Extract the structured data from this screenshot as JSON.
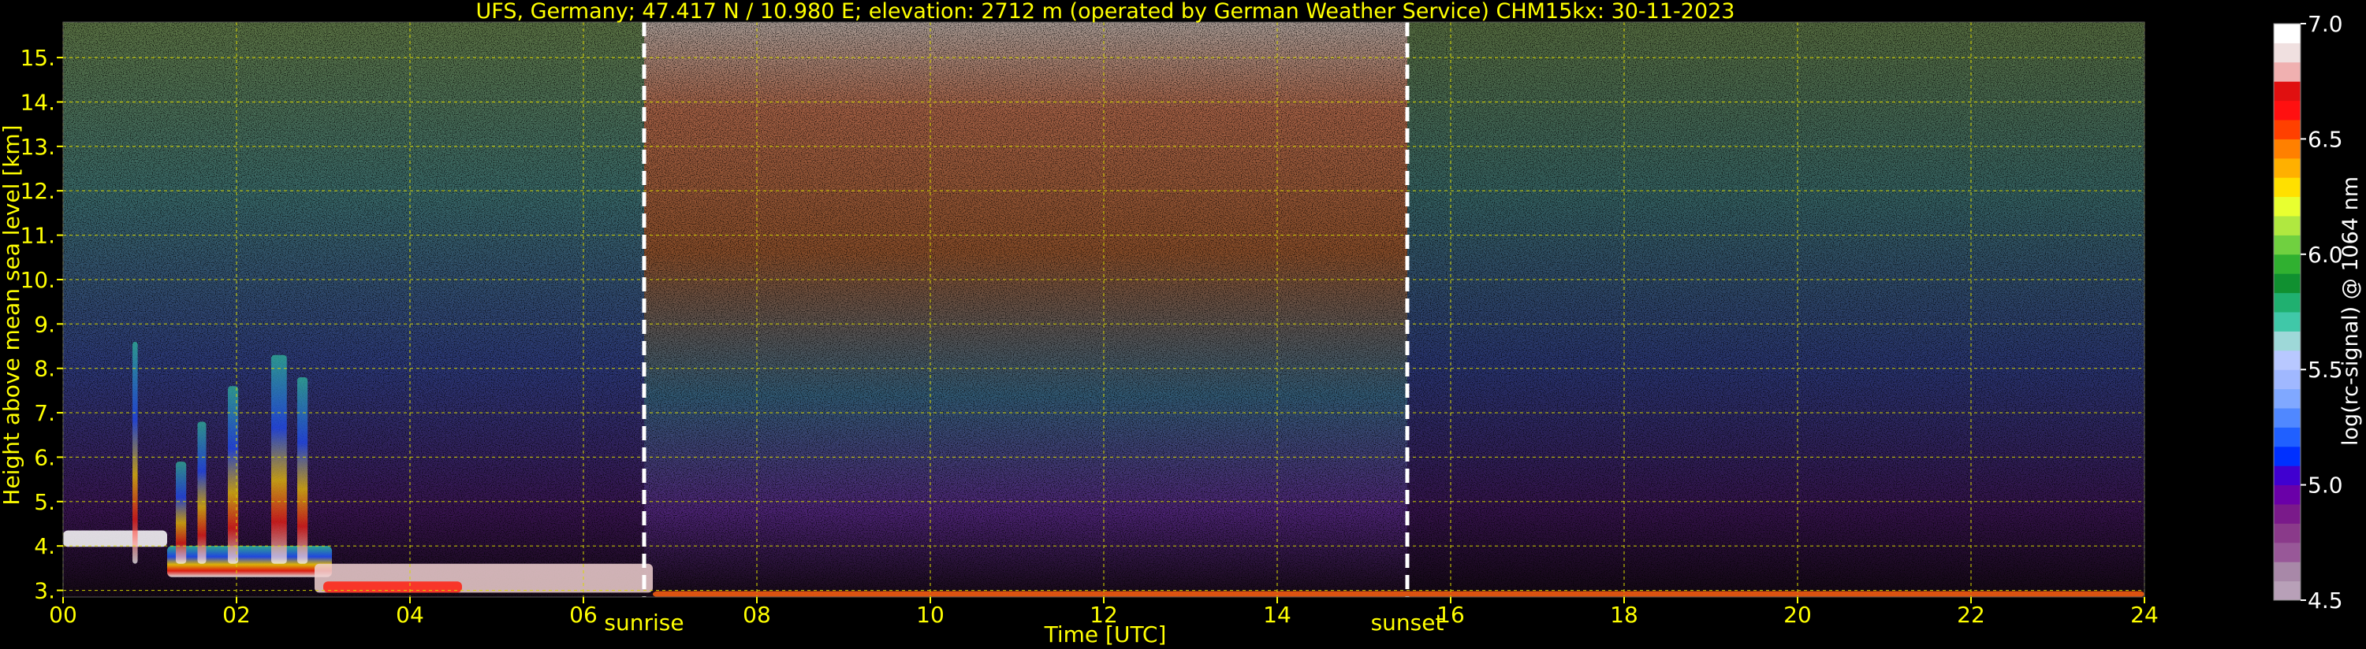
{
  "chart_data": {
    "type": "heatmap",
    "title": "UFS, Germany; 47.417 N / 10.980 E; elevation: 2712 m  (operated by German Weather Service)    CHM15kx: 30-11-2023",
    "xlabel": "Time [UTC]",
    "ylabel": "Height above mean sea level [km]",
    "xlim": [
      0,
      24
    ],
    "ylim": [
      2.85,
      15.8
    ],
    "x_ticks": [
      "00",
      "02",
      "04",
      "06",
      "08",
      "10",
      "12",
      "14",
      "16",
      "18",
      "20",
      "22",
      "24"
    ],
    "y_ticks": [
      "3.",
      "4.",
      "5.",
      "6.",
      "7.",
      "8.",
      "9.",
      "10.",
      "11.",
      "12.",
      "13.",
      "14.",
      "15."
    ],
    "grid": true,
    "annotations": [
      {
        "label": "sunrise",
        "x": 6.7
      },
      {
        "label": "sunset",
        "x": 15.5
      }
    ],
    "colorbar": {
      "label": "log(rc-signal) @ 1064 nm",
      "ticks": [
        "4.5",
        "5.0",
        "5.5",
        "6.0",
        "6.5",
        "7.0"
      ],
      "range": [
        4.5,
        7.0
      ],
      "colors": [
        "#b8a0b8",
        "#a888a8",
        "#985898",
        "#8a3a8a",
        "#7a1a8a",
        "#6a00a8",
        "#4000d0",
        "#0030ff",
        "#2060ff",
        "#5088ff",
        "#80a8ff",
        "#a0b8ff",
        "#b8c8ff",
        "#9ed8d8",
        "#40c8a8",
        "#20b070",
        "#109030",
        "#30b030",
        "#70d040",
        "#b0e840",
        "#e8ff30",
        "#ffe000",
        "#ffb000",
        "#ff8000",
        "#ff4000",
        "#ff1010",
        "#e01010",
        "#f0b0b0",
        "#f0e0e0",
        "#ffffff"
      ]
    }
  }
}
